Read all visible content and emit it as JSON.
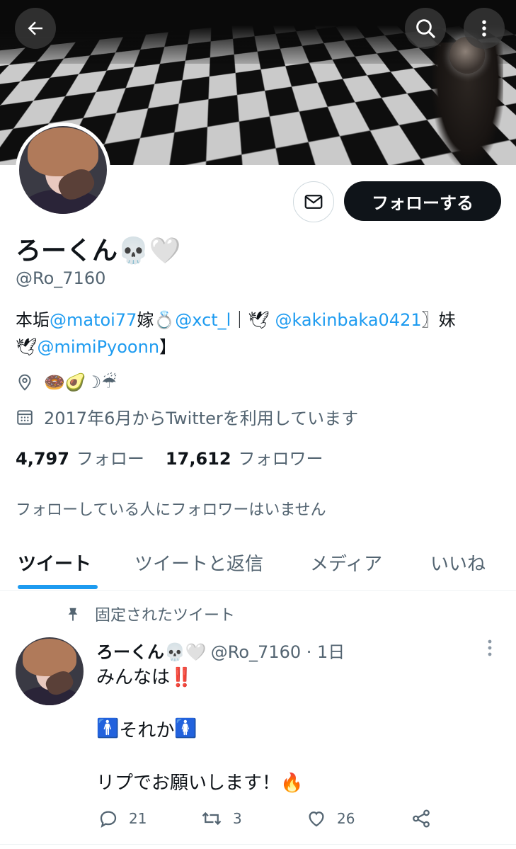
{
  "header": {
    "back_icon": "arrow-left-icon",
    "search_icon": "search-icon",
    "more_icon": "more-vertical-icon"
  },
  "profile": {
    "display_name": "ろーくん💀🤍",
    "handle": "@Ro_7160",
    "follow_button": "フォローする",
    "message_icon": "mail-icon",
    "bio": {
      "t1": "本垢",
      "m1": "@matoi77",
      "t2": "嫁💍",
      "m2": "@xct_l",
      "t3": "｜🕊 ",
      "m3": "@kakinbaka0421",
      "t4": "〗妹",
      "t5": "🕊",
      "m4": "@mimiPyoonn",
      "t6": "】"
    },
    "location": "🍩🥑☽☔",
    "joined": "2017年6月からTwitterを利用しています",
    "following_count": "4,797",
    "following_label": "フォロー",
    "followers_count": "17,612",
    "followers_label": "フォロワー",
    "mutuals_note": "フォローしている人にフォロワーはいません"
  },
  "tabs": [
    {
      "label": "ツイート",
      "active": true
    },
    {
      "label": "ツイートと返信",
      "active": false
    },
    {
      "label": "メディア",
      "active": false
    },
    {
      "label": "いいね",
      "active": false
    }
  ],
  "pinned_tweet": {
    "pinned_label": "固定されたツイート",
    "author_name": "ろーくん💀🤍",
    "author_handle": "@Ro_7160 · 1日",
    "line1": "みんなは‼️",
    "line2_sign_left": "🚹",
    "line2_text": "それか",
    "line2_sign_right": "🚺",
    "line3": "リプでお願いします！🔥",
    "reply_count": "21",
    "retweet_count": "3",
    "like_count": "26"
  },
  "colors": {
    "accent": "#1d9bf0",
    "text": "#0f1419",
    "secondary": "#536471",
    "follow_button_bg": "#0f1419"
  }
}
